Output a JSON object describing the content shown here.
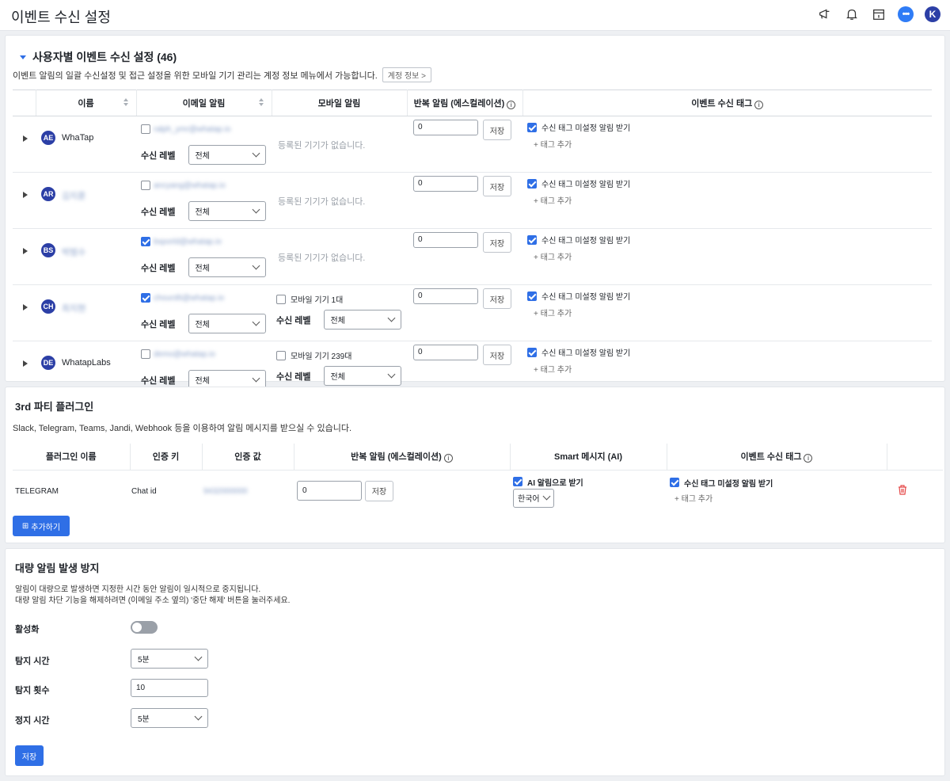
{
  "header": {
    "title": "이벤트 수신 설정",
    "icons": [
      "megaphone-icon",
      "bell-icon",
      "calendar-icon",
      "chat-icon",
      "user-avatar"
    ],
    "avatar_letter": "K",
    "chat_glyph": "•••"
  },
  "user_section": {
    "title": "사용자별 이벤트 수신 설정 (46)",
    "description": "이벤트 알림의 일괄 수신설정 및 접근 설정을 위한 모바일 기기 관리는 계정 정보 메뉴에서 가능합니다.",
    "account_link": "계정 정보 >",
    "columns": [
      "이름",
      "이메일 알림",
      "모바일 알림",
      "반복 알림 (에스컬레이션)",
      "이벤트 수신 태그"
    ],
    "level_label": "수신 레벨",
    "level_value": "전체",
    "no_device": "등록된 기기가 없습니다.",
    "save_label": "저장",
    "tag_checkbox_label": "수신 태그 미설정 알림 받기",
    "tag_add": "+ 태그 추가",
    "rows": [
      {
        "initials": "AE",
        "name": "WhaTap",
        "email": "ralph_ymr@whatap.io",
        "email_checked": false,
        "mobile": "",
        "repeat": "0"
      },
      {
        "initials": "AR",
        "name": "김지훈",
        "email": "ancyang@whatap.io",
        "email_checked": false,
        "mobile": "",
        "repeat": "0"
      },
      {
        "initials": "BS",
        "name": "박범수",
        "email": "bsporld@whatap.io",
        "email_checked": true,
        "mobile": "",
        "repeat": "0"
      },
      {
        "initials": "CH",
        "name": "최지현",
        "email": "chourd6@whatap.io",
        "email_checked": true,
        "mobile": "모바일 기기 1대",
        "repeat": "0"
      },
      {
        "initials": "DE",
        "name": "WhatapLabs",
        "email": "demo@whatap.io",
        "email_checked": false,
        "mobile": "모바일 기기 239대",
        "repeat": "0"
      }
    ]
  },
  "plugin_section": {
    "title": "3rd 파티 플러그인",
    "description": "Slack, Telegram, Teams, Jandi, Webhook 등을 이용하여 알림 메시지를 받으실 수 있습니다.",
    "columns": [
      "플러그인 이름",
      "인증 키",
      "인증 값",
      "반복 알림 (에스컬레이션)",
      "Smart 메시지 (AI)",
      "이벤트 수신 태그"
    ],
    "row": {
      "name": "TELEGRAM",
      "auth_key": "Chat id",
      "auth_value": "9432000000",
      "repeat": "0",
      "save_label": "저장",
      "ai_label": "AI 알림으로 받기",
      "language": "한국어",
      "tag_checkbox_label": "수신 태그 미설정 알림 받기",
      "tag_add": "+ 태그 추가"
    },
    "add_button": "추가하기"
  },
  "flood_section": {
    "title": "대량 알림 발생 방지",
    "desc_line1": "알림이 대량으로 발생하면 지정한 시간 동안 알림이 일시적으로 중지됩니다.",
    "desc_line2": "대량 알림 차단 기능을 해제하려면 (이메일 주소 옆의) '중단 해제' 버튼을 눌러주세요.",
    "active_label": "활성화",
    "active_on": false,
    "detect_time_label": "탐지 시간",
    "detect_time_value": "5분",
    "detect_count_label": "탐지 횟수",
    "detect_count_value": "10",
    "stop_time_label": "정지 시간",
    "stop_time_value": "5분",
    "save_label": "저장"
  },
  "colors": {
    "accent": "#2f6fe6",
    "avatar": "#2c3fa6",
    "delete": "#e54848"
  }
}
